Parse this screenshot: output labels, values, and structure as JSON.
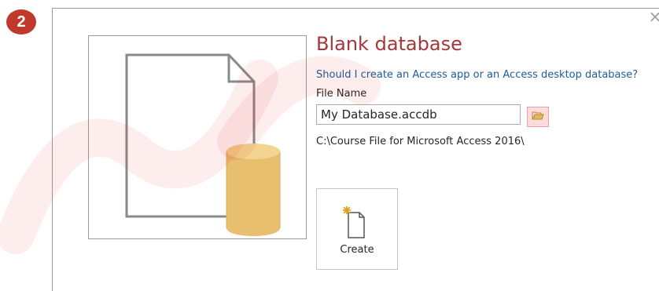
{
  "step": {
    "number": "2"
  },
  "dialog": {
    "close_icon": "close-icon",
    "title": "Blank database",
    "help_link": "Should I create an Access app or an Access desktop database?",
    "file_name_label": "File Name",
    "file_name_value": "My Database.accdb",
    "browse_icon": "folder-open-icon",
    "file_path": "C:\\Course File for Microsoft Access 2016\\",
    "create_label": "Create",
    "create_icon": "new-document-icon"
  },
  "colors": {
    "badge": "#c0392b",
    "title": "#a4373a",
    "link": "#1f5c99",
    "browse_bg": "#fbdcdc",
    "cylinder": "#e7bf6f",
    "watermark": "#e60000"
  }
}
